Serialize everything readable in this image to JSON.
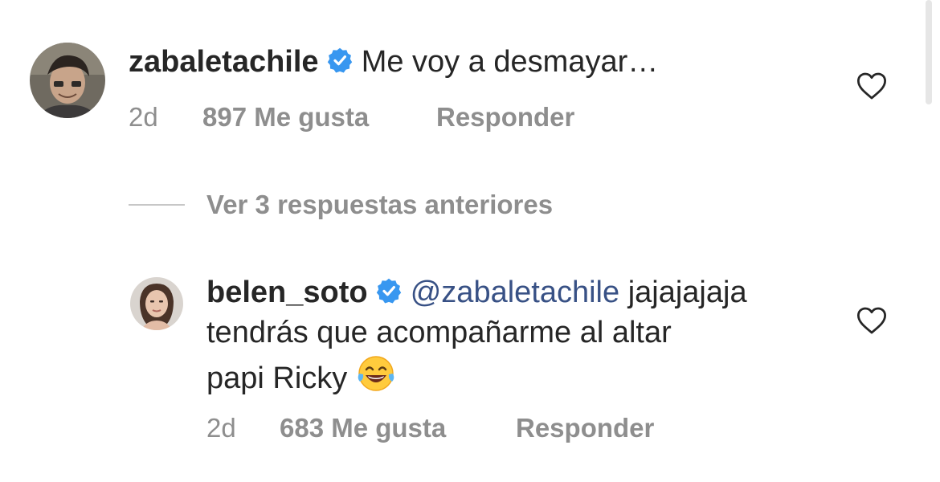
{
  "comments": [
    {
      "username": "zabaletachile",
      "verified": true,
      "text": "Me voy a desmayar…",
      "age": "2d",
      "likes": "897 Me gusta",
      "reply": "Responder"
    },
    {
      "username": "belen_soto",
      "verified": true,
      "mention": "@zabaletachile",
      "text_line1": "jajajajaja",
      "text_line2": "tendrás que acompañarme al altar",
      "text_line3": "papi Ricky",
      "emoji": "face-with-tears-of-joy",
      "age": "2d",
      "likes": "683 Me gusta",
      "reply": "Responder"
    }
  ],
  "view_replies": "Ver 3 respuestas anteriores",
  "colors": {
    "text": "#262626",
    "secondary": "#8e8e8e",
    "mention": "#385185",
    "verified": "#3897f0"
  }
}
